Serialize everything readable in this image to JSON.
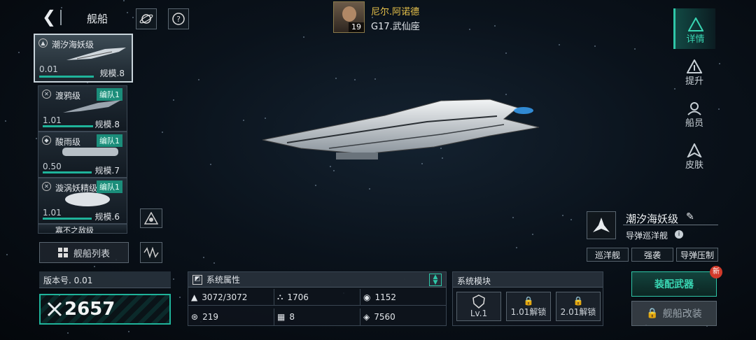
{
  "header": {
    "back_icon": "back-arrow-icon",
    "title": "舰船"
  },
  "player": {
    "name": "尼尔.阿诺德",
    "level": "19",
    "location": "G17.武仙座"
  },
  "ships": [
    {
      "name": "潮汐海妖级",
      "version": "0.01",
      "scale": "规模.8",
      "fleet": ""
    },
    {
      "name": "渡鸦级",
      "version": "1.01",
      "scale": "规模.8",
      "fleet": "编队1"
    },
    {
      "name": "酸雨级",
      "version": "0.50",
      "scale": "规模.7",
      "fleet": "编队1"
    },
    {
      "name": "漩涡妖精级",
      "version": "1.01",
      "scale": "规模.6",
      "fleet": "编队1"
    },
    {
      "name": "寡不之敌级",
      "version": "",
      "scale": "",
      "fleet": ""
    }
  ],
  "ship_list_button": "舰船列表",
  "right_tabs": [
    "详情",
    "提升",
    "船员",
    "皮肤"
  ],
  "selected": {
    "name": "潮汐海妖级",
    "type": "导弹巡洋舰",
    "tags": [
      "巡洋舰",
      "强袭",
      "导弹压制"
    ]
  },
  "version_panel": {
    "label": "版本号. 0.01",
    "power": "2657"
  },
  "attributes": {
    "title": "系统属性",
    "values": [
      "3072/3072",
      "1706",
      "1152",
      "219",
      "8",
      "7560"
    ]
  },
  "modules": {
    "title": "系统模块",
    "slots": [
      "Lv.1",
      "1.01解锁",
      "2.01解锁"
    ]
  },
  "actions": {
    "equip": "装配武器",
    "modify": "舰船改装",
    "new_badge": "新"
  },
  "colors": {
    "accent": "#2fc7a8",
    "fleet_badge": "#1b8d7a",
    "player_name": "#e8c24a"
  }
}
